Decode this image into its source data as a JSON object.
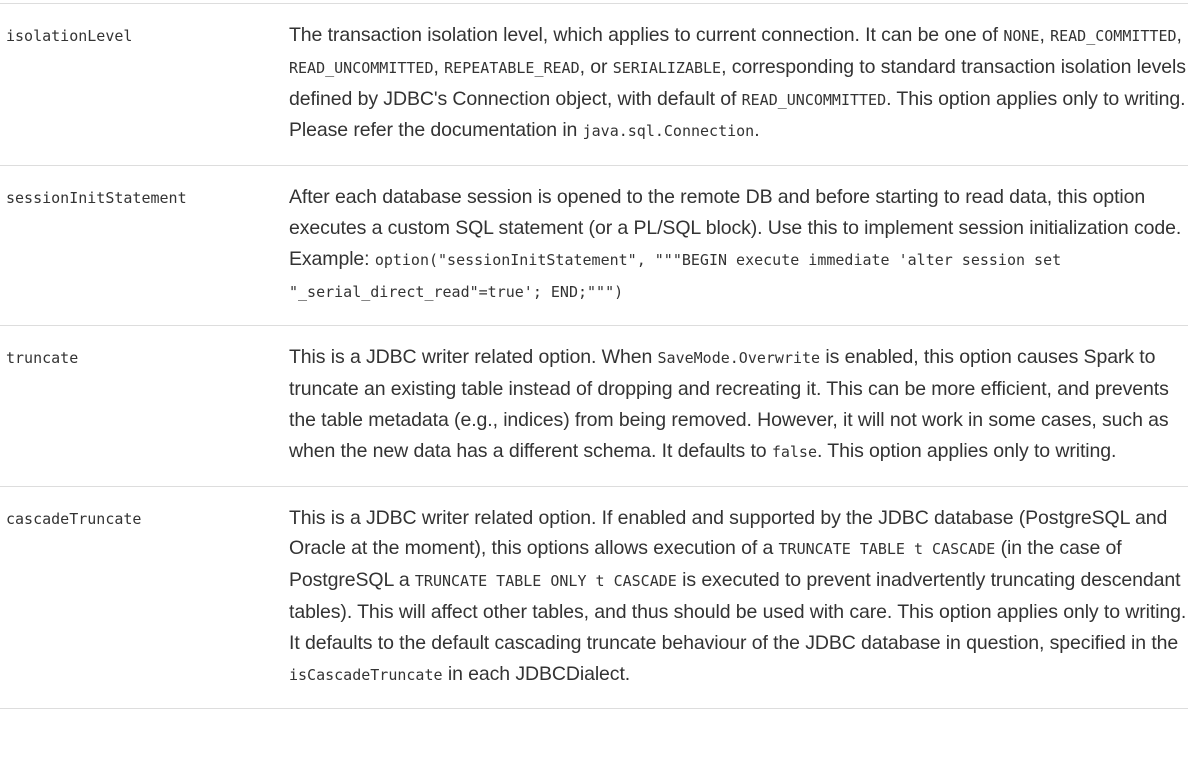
{
  "rows": [
    {
      "name": "isolationLevel",
      "description": [
        {
          "t": "text",
          "v": "The transaction isolation level, which applies to current connection. It can be one of "
        },
        {
          "t": "code",
          "v": "NONE"
        },
        {
          "t": "text",
          "v": ", "
        },
        {
          "t": "code",
          "v": "READ_COMMITTED"
        },
        {
          "t": "text",
          "v": ", "
        },
        {
          "t": "code",
          "v": "READ_UNCOMMITTED"
        },
        {
          "t": "text",
          "v": ", "
        },
        {
          "t": "code",
          "v": "REPEATABLE_READ"
        },
        {
          "t": "text",
          "v": ", or "
        },
        {
          "t": "code",
          "v": "SERIALIZABLE"
        },
        {
          "t": "text",
          "v": ", corresponding to standard transaction isolation levels defined by JDBC's Connection object, with default of "
        },
        {
          "t": "code",
          "v": "READ_UNCOMMITTED"
        },
        {
          "t": "text",
          "v": ". This option applies only to writing. Please refer the documentation in "
        },
        {
          "t": "code",
          "v": "java.sql.Connection"
        },
        {
          "t": "text",
          "v": "."
        }
      ]
    },
    {
      "name": "sessionInitStatement",
      "description": [
        {
          "t": "text",
          "v": "After each database session is opened to the remote DB and before starting to read data, this option executes a custom SQL statement (or a PL/SQL block). Use this to implement session initialization code. Example: "
        },
        {
          "t": "code",
          "v": "option(\"sessionInitStatement\", \"\"\"BEGIN execute immediate 'alter session set \"_serial_direct_read\"=true'; END;\"\"\")"
        }
      ]
    },
    {
      "name": "truncate",
      "description": [
        {
          "t": "text",
          "v": "This is a JDBC writer related option. When "
        },
        {
          "t": "code",
          "v": "SaveMode.Overwrite"
        },
        {
          "t": "text",
          "v": " is enabled, this option causes Spark to truncate an existing table instead of dropping and recreating it. This can be more efficient, and prevents the table metadata (e.g., indices) from being removed. However, it will not work in some cases, such as when the new data has a different schema. It defaults to "
        },
        {
          "t": "code",
          "v": "false"
        },
        {
          "t": "text",
          "v": ". This option applies only to writing."
        }
      ]
    },
    {
      "name": "cascadeTruncate",
      "description": [
        {
          "t": "text",
          "v": "This is a JDBC writer related option. If enabled and supported by the JDBC database (PostgreSQL and Oracle at the moment), this options allows execution of a "
        },
        {
          "t": "code",
          "v": "TRUNCATE TABLE t CASCADE"
        },
        {
          "t": "text",
          "v": " (in the case of PostgreSQL a "
        },
        {
          "t": "code",
          "v": "TRUNCATE TABLE ONLY t CASCADE"
        },
        {
          "t": "text",
          "v": " is executed to prevent inadvertently truncating descendant tables). This will affect other tables, and thus should be used with care. This option applies only to writing. It defaults to the default cascading truncate behaviour of the JDBC database in question, specified in the "
        },
        {
          "t": "code",
          "v": "isCascadeTruncate"
        },
        {
          "t": "text",
          "v": " in each JDBCDialect."
        }
      ]
    }
  ]
}
